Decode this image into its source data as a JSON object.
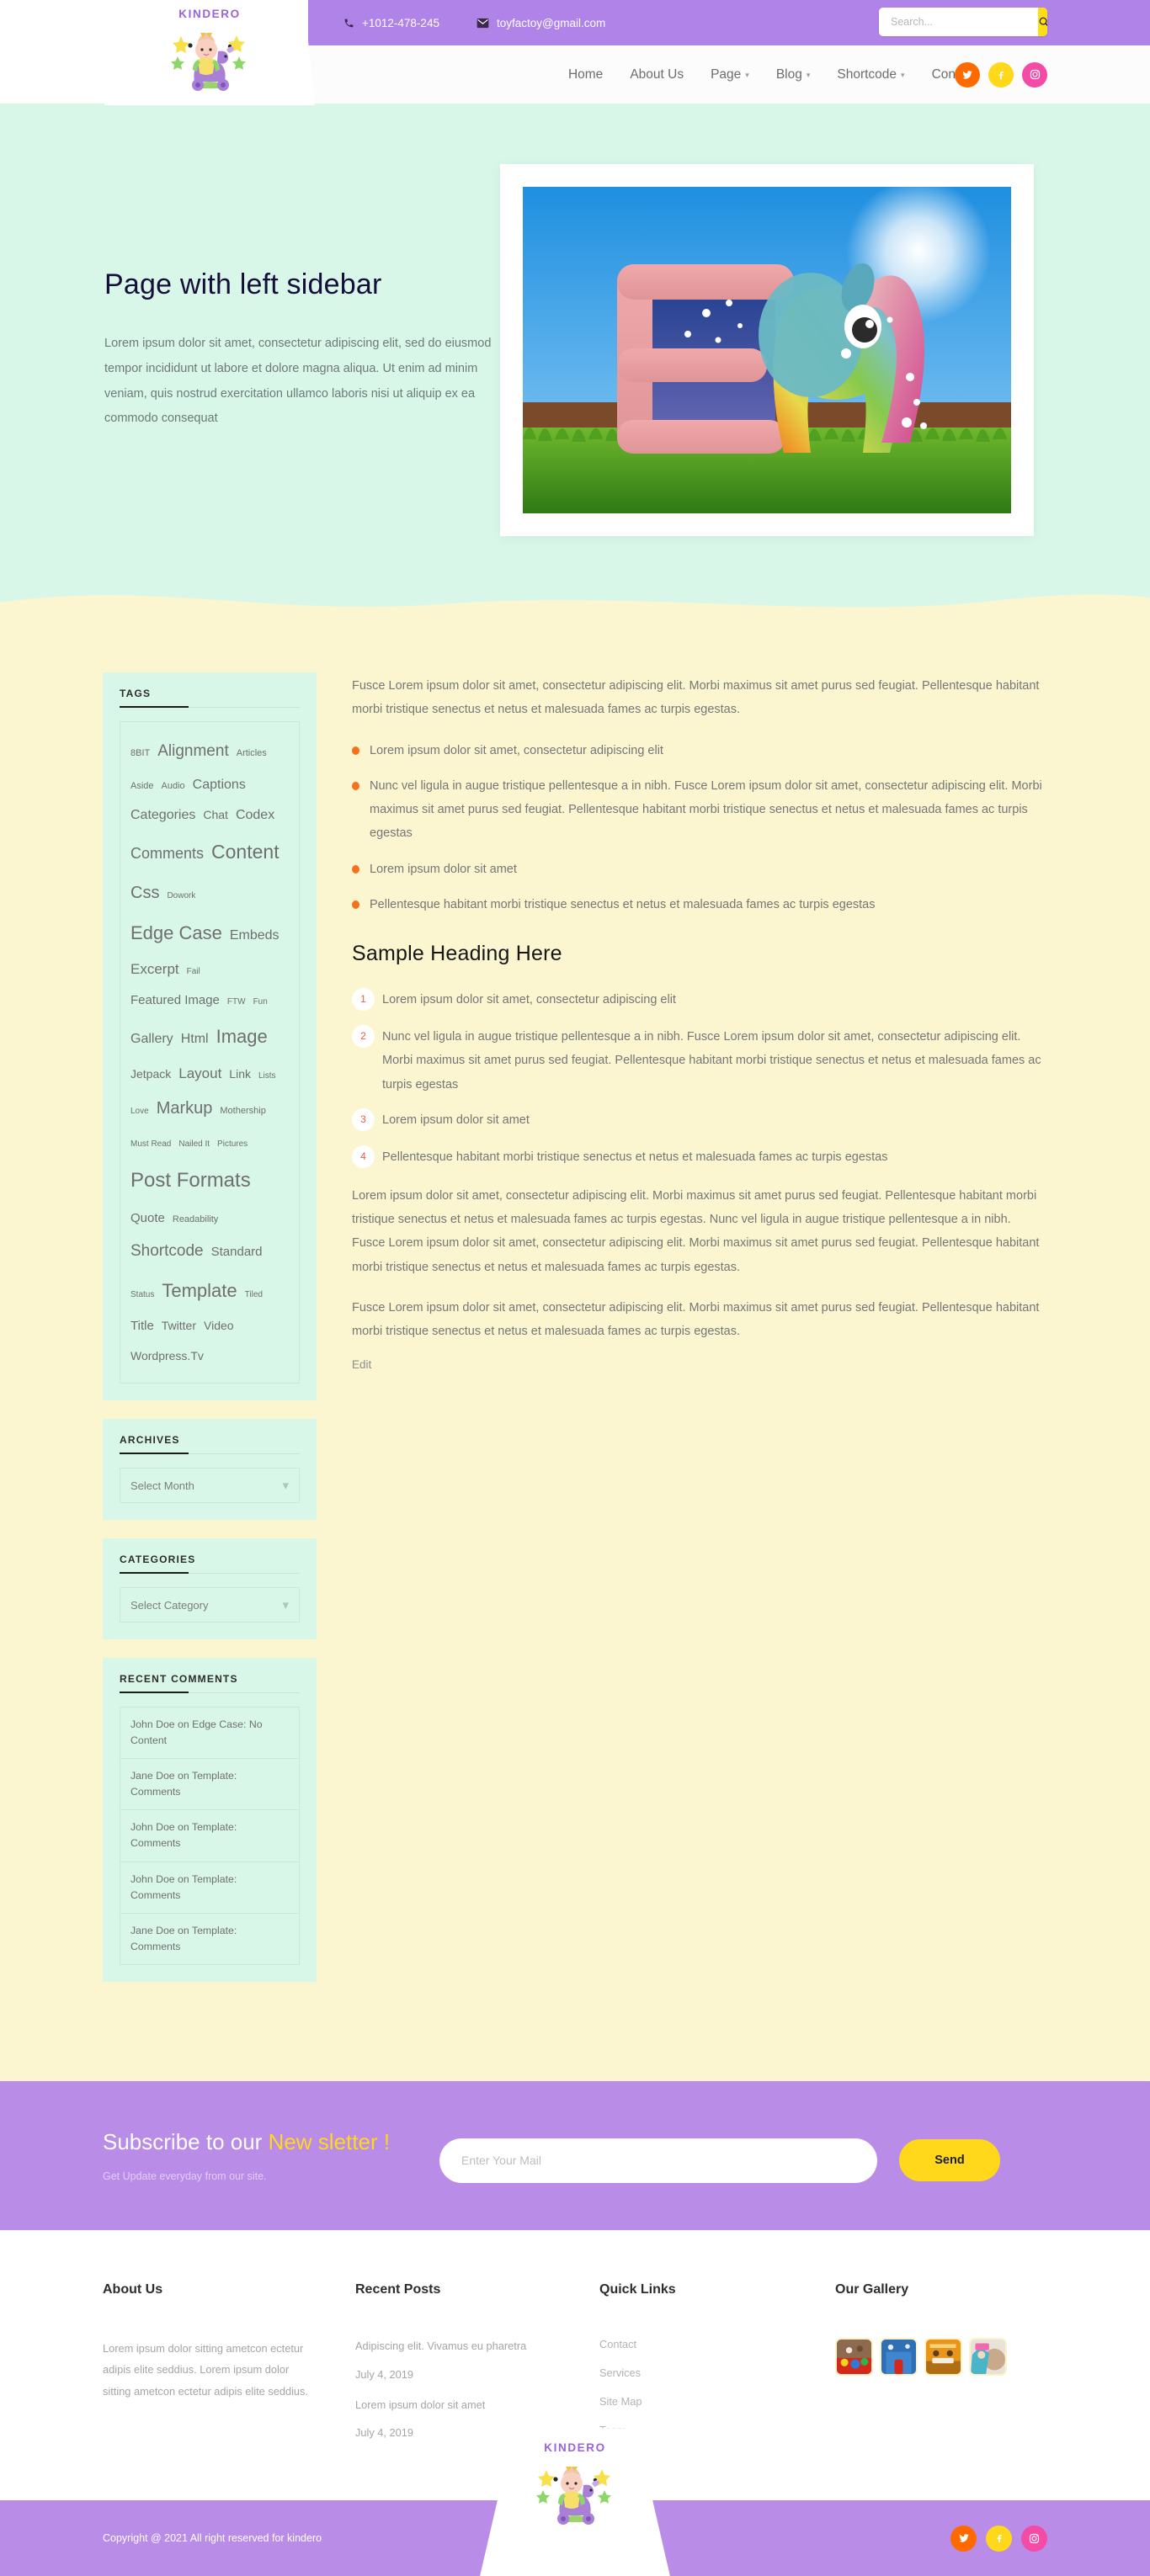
{
  "header": {
    "phone": "+1012-478-245",
    "email": "toyfactoy@gmail.com",
    "search_placeholder": "Search...",
    "logo_text": "KINDERO",
    "nav": [
      {
        "label": "Home",
        "caret": false
      },
      {
        "label": "About Us",
        "caret": false
      },
      {
        "label": "Page",
        "caret": true
      },
      {
        "label": "Blog",
        "caret": true
      },
      {
        "label": "Shortcode",
        "caret": true
      },
      {
        "label": "Contact",
        "caret": false
      }
    ],
    "socials": [
      "twitter-icon",
      "facebook-icon",
      "instagram-icon"
    ]
  },
  "hero": {
    "title": "Page with left sidebar",
    "text": "Lorem ipsum dolor sit amet, consectetur adipiscing elit, sed do eiusmod tempor incididunt ut labore et dolore magna aliqua. Ut enim ad minim veniam, quis nostrud exercitation ullamco laboris nisi ut aliquip ex ea commodo consequat",
    "image_alt": "letter-e-elephant-toy"
  },
  "sidebar": {
    "tags_title": "TAGS",
    "tags": [
      {
        "label": "8BIT",
        "size": 11
      },
      {
        "label": "Alignment",
        "size": 19
      },
      {
        "label": "Articles",
        "size": 11
      },
      {
        "label": "Aside",
        "size": 11
      },
      {
        "label": "Audio",
        "size": 11
      },
      {
        "label": "Captions",
        "size": 16
      },
      {
        "label": "Categories",
        "size": 16
      },
      {
        "label": "Chat",
        "size": 14
      },
      {
        "label": "Codex",
        "size": 16
      },
      {
        "label": "Comments",
        "size": 18
      },
      {
        "label": "Content",
        "size": 23
      },
      {
        "label": "Css",
        "size": 20
      },
      {
        "label": "Dowork",
        "size": 10
      },
      {
        "label": "Edge Case",
        "size": 22
      },
      {
        "label": "Embeds",
        "size": 16
      },
      {
        "label": "Excerpt",
        "size": 17
      },
      {
        "label": "Fail",
        "size": 10
      },
      {
        "label": "Featured Image",
        "size": 15
      },
      {
        "label": "FTW",
        "size": 10
      },
      {
        "label": "Fun",
        "size": 10
      },
      {
        "label": "Gallery",
        "size": 16
      },
      {
        "label": "Html",
        "size": 16
      },
      {
        "label": "Image",
        "size": 22
      },
      {
        "label": "Jetpack",
        "size": 14
      },
      {
        "label": "Layout",
        "size": 17
      },
      {
        "label": "Link",
        "size": 14
      },
      {
        "label": "Lists",
        "size": 10
      },
      {
        "label": "Love",
        "size": 10
      },
      {
        "label": "Markup",
        "size": 20
      },
      {
        "label": "Mothership",
        "size": 11
      },
      {
        "label": "Must Read",
        "size": 10
      },
      {
        "label": "Nailed It",
        "size": 10
      },
      {
        "label": "Pictures",
        "size": 10
      },
      {
        "label": "Post Formats",
        "size": 24
      },
      {
        "label": "Quote",
        "size": 15
      },
      {
        "label": "Readability",
        "size": 11
      },
      {
        "label": "Shortcode",
        "size": 19
      },
      {
        "label": "Standard",
        "size": 15
      },
      {
        "label": "Status",
        "size": 10
      },
      {
        "label": "Template",
        "size": 22
      },
      {
        "label": "Tiled",
        "size": 10
      },
      {
        "label": "Title",
        "size": 15
      },
      {
        "label": "Twitter",
        "size": 14
      },
      {
        "label": "Video",
        "size": 14
      },
      {
        "label": "Wordpress.Tv",
        "size": 14
      }
    ],
    "archives_title": "ARCHIVES",
    "archives_value": "Select Month",
    "categories_title": "CATEGORIES",
    "categories_value": "Select Category",
    "comments_title": "RECENT COMMENTS",
    "comments": [
      "John Doe on Edge Case: No Content",
      "Jane Doe on Template: Comments",
      "John Doe on Template: Comments",
      "John Doe on Template: Comments",
      "Jane Doe on Template: Comments"
    ]
  },
  "content": {
    "intro": "Fusce Lorem ipsum dolor sit amet, consectetur adipiscing elit. Morbi maximus sit amet purus sed feugiat. Pellentesque habitant morbi tristique senectus et netus et malesuada fames ac turpis egestas.",
    "bullets": [
      "Lorem ipsum dolor sit amet, consectetur adipiscing elit",
      "Nunc vel ligula in augue tristique pellentesque a in nibh. Fusce Lorem ipsum dolor sit amet, consectetur adipiscing elit. Morbi maximus sit amet purus sed feugiat. Pellentesque habitant morbi tristique senectus et netus et malesuada fames ac turpis egestas",
      "Lorem ipsum dolor sit amet",
      "Pellentesque habitant morbi tristique senectus et netus et malesuada fames ac turpis egestas"
    ],
    "heading": "Sample Heading Here",
    "numbered": [
      {
        "n": "1",
        "text": "Lorem ipsum dolor sit amet, consectetur adipiscing elit"
      },
      {
        "n": "2",
        "text": "Nunc vel ligula in augue tristique pellentesque a in nibh. Fusce Lorem ipsum dolor sit amet, consectetur adipiscing elit. Morbi maximus sit amet purus sed feugiat. Pellentesque habitant morbi tristique senectus et netus et malesuada fames ac turpis egestas"
      },
      {
        "n": "3",
        "text": "Lorem ipsum dolor sit amet"
      },
      {
        "n": "4",
        "text": "Pellentesque habitant morbi tristique senectus et netus et malesuada fames ac turpis egestas"
      }
    ],
    "para1": "Lorem ipsum dolor sit amet, consectetur adipiscing elit. Morbi maximus sit amet purus sed feugiat. Pellentesque habitant morbi tristique senectus et netus et malesuada fames ac turpis egestas. Nunc vel ligula in augue tristique pellentesque a in nibh. Fusce Lorem ipsum dolor sit amet, consectetur adipiscing elit. Morbi maximus sit amet purus sed feugiat. Pellentesque habitant morbi tristique senectus et netus et malesuada fames ac turpis egestas.",
    "para2": "Fusce Lorem ipsum dolor sit amet, consectetur adipiscing elit. Morbi maximus sit amet purus sed feugiat. Pellentesque habitant morbi tristique senectus et netus et malesuada fames ac turpis egestas.",
    "edit_label": "Edit"
  },
  "newsletter": {
    "title_1": "Subscribe to our ",
    "title_hl": "New sletter !",
    "subtitle": "Get Update everyday from our site.",
    "placeholder": "Enter Your Mail",
    "button": "Send"
  },
  "footer": {
    "about_title": "About Us",
    "about_text": "Lorem ipsum dolor sitting ametcon ectetur adipis elite seddius. Lorem ipsum dolor sitting ametcon ectetur adipis elite seddius.",
    "recent_title": "Recent Posts",
    "recent": [
      {
        "title": "Adipiscing elit. Vivamus eu pharetra",
        "date": "July 4, 2019"
      },
      {
        "title": "Lorem ipsum dolor sit amet",
        "date": "July 4, 2019"
      }
    ],
    "links_title": "Quick Links",
    "links": [
      "Contact",
      "Services",
      "Site Map",
      "Team"
    ],
    "gallery_title": "Our Gallery",
    "gallery": [
      "gallery-thumb-1",
      "gallery-thumb-2",
      "gallery-thumb-3",
      "gallery-thumb-4"
    ],
    "copyright": "Copyright @ 2021 All right reserved for kindero",
    "logo_text": "KINDERO",
    "socials": [
      "twitter-icon",
      "facebook-icon",
      "instagram-icon"
    ]
  },
  "colors": {
    "purple": "#b98ce8",
    "mint": "#d8f7e9",
    "cream": "#fbf6cf",
    "yellow": "#ffd81c",
    "orange": "#ff6a00",
    "pink": "#f44ba6"
  }
}
